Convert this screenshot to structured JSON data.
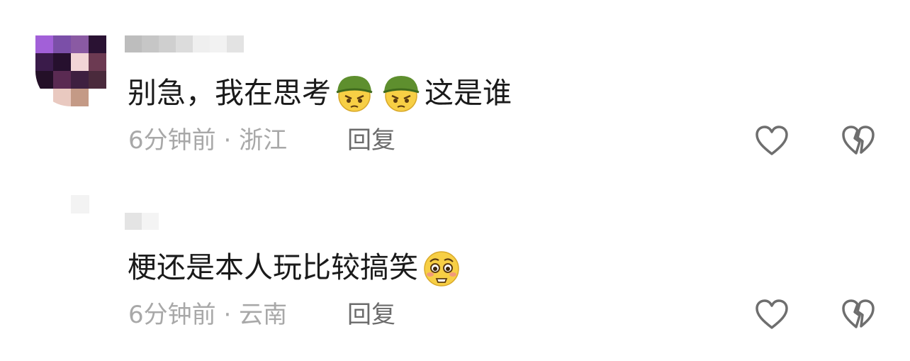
{
  "comments": [
    {
      "text_parts": [
        "别急，我在思考",
        "这是谁"
      ],
      "emojis": [
        "thinking-helmet-emoji",
        "thinking-helmet-emoji"
      ],
      "time": "6分钟前",
      "separator": "·",
      "location": "浙江",
      "reply_label": "回复"
    },
    {
      "text_parts": [
        "梗还是本人玩比较搞笑"
      ],
      "emojis": [
        "pleading-emoji"
      ],
      "time": "6分钟前",
      "separator": "·",
      "location": "云南",
      "reply_label": "回复"
    }
  ],
  "icons": {
    "like": "heart-outline-icon",
    "dislike": "broken-heart-outline-icon"
  },
  "colors": {
    "meta_text": "#a8a8a8",
    "reply_text": "#6b6b6b",
    "icon_stroke": "#6e6e6e",
    "emoji_face": "#f7cf45",
    "emoji_helmet": "#5e8f2e"
  }
}
